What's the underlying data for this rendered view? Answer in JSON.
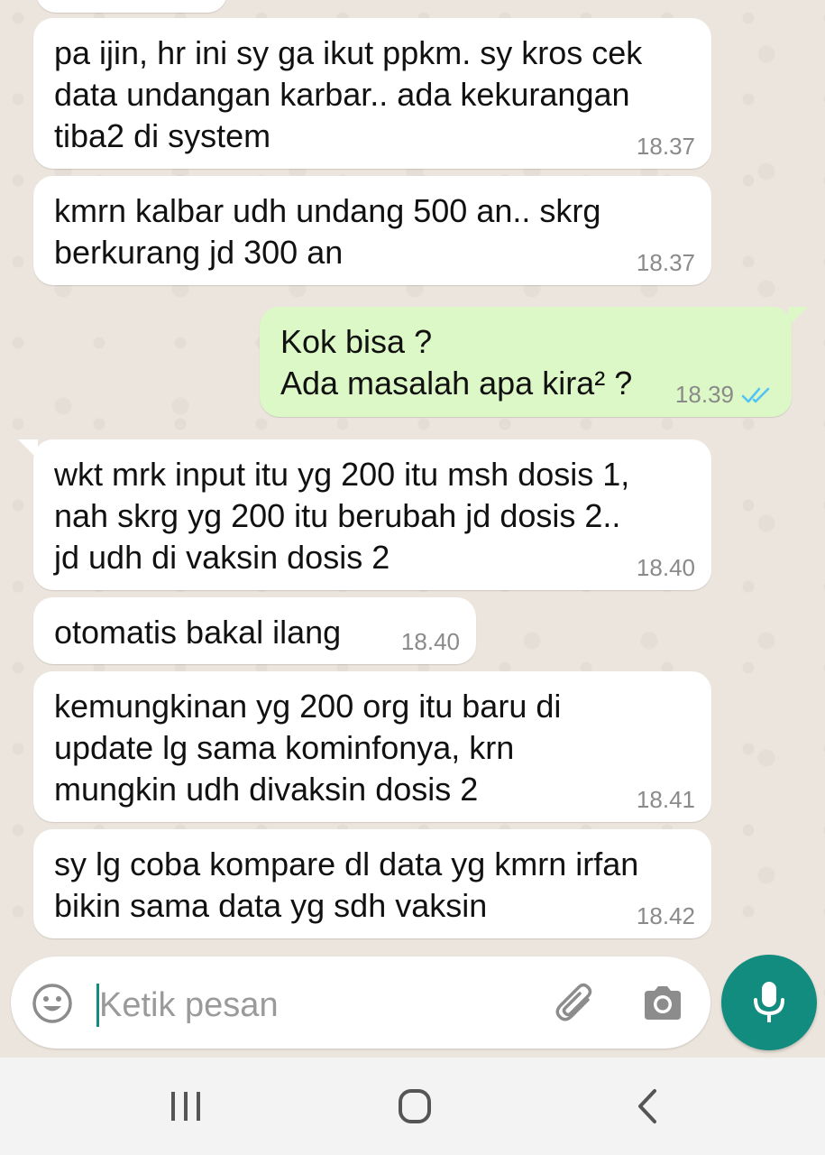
{
  "messages": [
    {
      "direction": "in",
      "text": "pa ijin, hr ini sy ga ikut ppkm. sy kros cek\ndata undangan karbar.. ada kekurangan\ntiba2 di system",
      "time": "18.37"
    },
    {
      "direction": "in",
      "text": "kmrn kalbar udh undang 500 an.. skrg\nberkurang jd 300 an",
      "time": "18.37"
    },
    {
      "direction": "out",
      "text": "Kok bisa ?\nAda masalah apa kira² ?",
      "time": "18.39",
      "status": "read-double-check-icon"
    },
    {
      "direction": "in",
      "text": "wkt mrk input itu yg 200 itu msh dosis 1,\nnah skrg yg 200 itu berubah jd dosis 2..\njd udh di vaksin dosis 2",
      "time": "18.40"
    },
    {
      "direction": "in",
      "text": "otomatis bakal ilang",
      "time": "18.40"
    },
    {
      "direction": "in",
      "text": "kemungkinan yg 200 org itu baru di\nupdate lg sama kominfonya, krn\nmungkin udh divaksin dosis 2",
      "time": "18.41"
    },
    {
      "direction": "in",
      "text": "sy lg coba kompare dl data yg kmrn irfan\nbikin sama data yg sdh vaksin",
      "time": "18.42"
    }
  ],
  "composer": {
    "placeholder": "Ketik pesan",
    "emoji_icon": "emoji-icon",
    "attach_icon": "paperclip-icon",
    "camera_icon": "camera-icon",
    "mic_icon": "microphone-icon"
  },
  "nav": {
    "recents_icon": "recents-icon",
    "home_icon": "home-icon",
    "back_icon": "back-icon"
  },
  "colors": {
    "chat_background": "#ece5dd",
    "incoming_bubble": "#ffffff",
    "outgoing_bubble": "#dcf8c6",
    "accent": "#128c7e",
    "read_ticks": "#4fc3f7"
  }
}
